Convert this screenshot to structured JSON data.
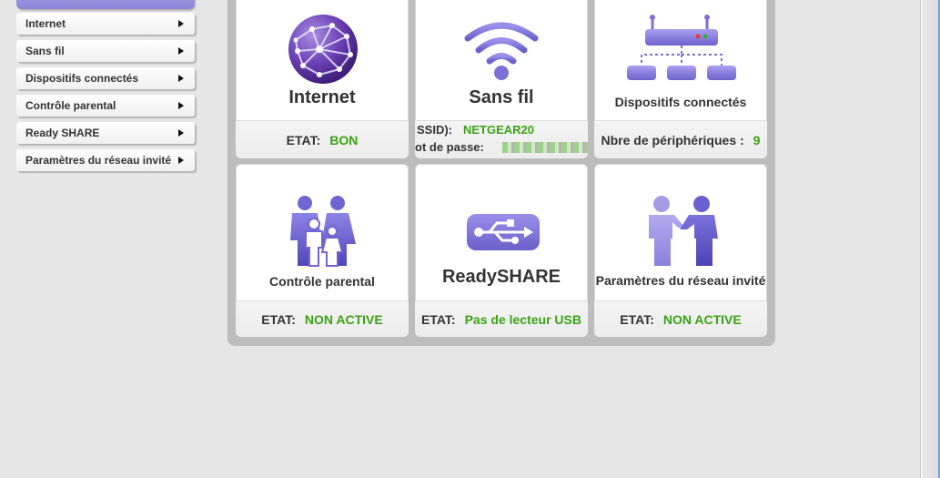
{
  "sidebar": {
    "items": [
      {
        "label": "Internet"
      },
      {
        "label": "Sans fil"
      },
      {
        "label": "Dispositifs connectés"
      },
      {
        "label": "Contrôle parental"
      },
      {
        "label": "Ready SHARE"
      },
      {
        "label": "Paramètres du réseau invité"
      }
    ]
  },
  "cards": {
    "internet": {
      "title": "Internet",
      "status_label": "ETAT:",
      "status_value": "BON"
    },
    "wireless": {
      "title": "Sans fil",
      "ssid_label": "SSID):",
      "ssid_value": "NETGEAR20",
      "password_label": "ot de passe:"
    },
    "devices": {
      "title": "Dispositifs connectés",
      "count_label": "Nbre de périphériques :",
      "count_value": "9"
    },
    "parental": {
      "title": "Contrôle parental",
      "status_label": "ETAT:",
      "status_value": "NON ACTIVE"
    },
    "readyshare": {
      "title": "ReadySHARE",
      "status_label": "ETAT:",
      "status_value": "Pas de lecteur USB"
    },
    "guest": {
      "title": "Paramètres du réseau invité",
      "status_label": "ETAT:",
      "status_value": "NON ACTIVE"
    }
  },
  "icons": {
    "internet": "globe-icon",
    "wireless": "wifi-icon",
    "devices": "router-icon",
    "parental": "family-icon",
    "readyshare": "usb-icon",
    "guest": "handshake-icon"
  },
  "colors": {
    "accent": "#7a6fd8",
    "status_ok": "#3ba216",
    "panel": "#bdbdbd"
  }
}
